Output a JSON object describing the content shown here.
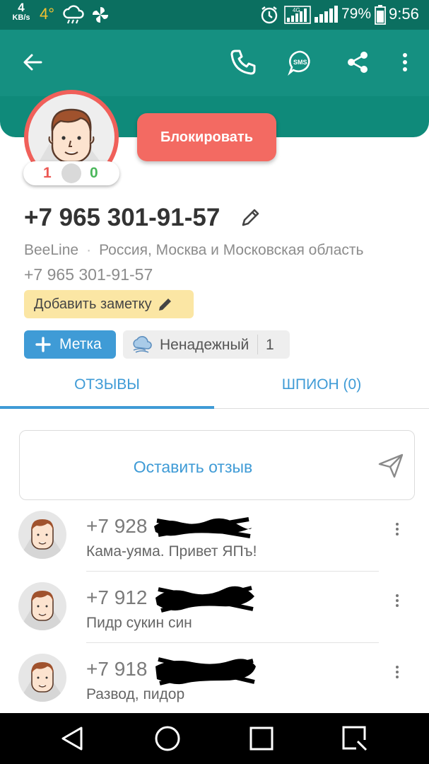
{
  "status_bar": {
    "net_speed_value": "4",
    "net_speed_unit": "KB/s",
    "weather_temp": "4°",
    "battery": "79%",
    "time": "9:56",
    "icons": [
      "rain-cloud-icon",
      "fan-icon",
      "alarm-icon",
      "4g-signal-icon",
      "cell-signal-icon",
      "battery-icon"
    ]
  },
  "toolbar": {
    "icons": [
      "back-arrow-icon",
      "phone-icon",
      "sms-icon",
      "share-icon",
      "more-vert-icon"
    ],
    "sms_label": "SMS"
  },
  "profile": {
    "rating_negative": "1",
    "rating_positive": "0",
    "block_label": "Блокировать",
    "phone": "+7 965 301-91-57",
    "operator": "BeeLine",
    "region": "Россия, Москва и Московская область",
    "phone_secondary": "+7 965 301-91-57",
    "add_note_label": "Добавить заметку",
    "tag_label": "Метка",
    "unreliable_label": "Ненадежный",
    "unreliable_count": "1"
  },
  "tabs": {
    "reviews": "ОТЗЫВЫ",
    "spy": "ШПИОН (0)",
    "active": "reviews"
  },
  "leave_review_label": "Оставить отзыв",
  "reviews": [
    {
      "phone_prefix": "+7 928",
      "text": "Кама-уяма. Привет ЯПъ!"
    },
    {
      "phone_prefix": "+7 912",
      "text": "Пидр сукин син"
    },
    {
      "phone_prefix": "+7 918",
      "text": "Развод, пидор"
    }
  ],
  "colors": {
    "status_bar": "#0b6f60",
    "app_bar": "#159081",
    "accent_blue": "#3f9bd6",
    "block_red": "#f36a62",
    "positive_green": "#4bb75b",
    "note_yellow": "#fbe6a4"
  },
  "nav_bar": {
    "icons": [
      "back-triangle-icon",
      "home-circle-icon",
      "recents-square-icon",
      "screenshot-icon"
    ]
  }
}
